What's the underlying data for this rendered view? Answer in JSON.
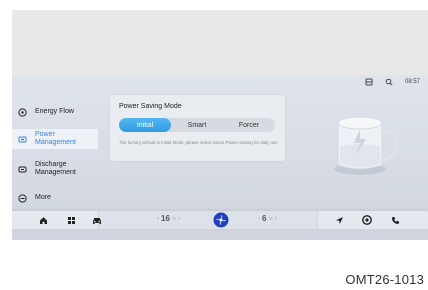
{
  "status_bar": {
    "time": "08:57",
    "icons": [
      "profile-icon",
      "network-icon"
    ]
  },
  "sidebar": {
    "items": [
      {
        "label": "Energy Flow",
        "icon": "energy-flow-icon",
        "active": false
      },
      {
        "label": "Power Management",
        "icon": "power-management-icon",
        "active": true
      },
      {
        "label": "Discharge Management",
        "icon": "discharge-icon",
        "active": false
      },
      {
        "label": "More",
        "icon": "more-icon",
        "active": false
      }
    ]
  },
  "panel": {
    "title": "Power Saving Mode",
    "options": [
      "Initial",
      "Smart",
      "Forcer"
    ],
    "selected": "Initial",
    "note": "The factory default is Initial Mode, please select Smart Power Saving for daily use."
  },
  "dock": {
    "left_temp": "16",
    "right_temp": "6",
    "temp_unit": "°C",
    "icons": [
      "home-icon",
      "apps-icon",
      "car-icon",
      "fan-icon",
      "navigation-icon",
      "media-icon",
      "phone-icon"
    ]
  },
  "colors": {
    "accent": "#2f86e6",
    "toggle": "#2e9ce5",
    "background": "#d9dee6"
  },
  "caption": "OMT26-1013"
}
